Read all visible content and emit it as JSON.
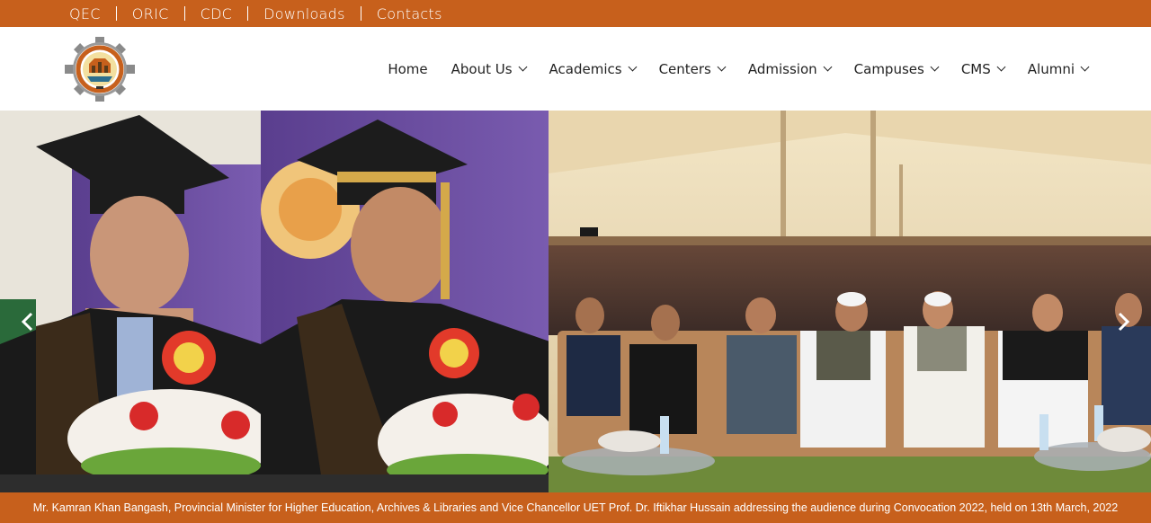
{
  "topbar": {
    "links": [
      "QEC",
      "ORIC",
      "CDC",
      "Downloads",
      "Contacts"
    ]
  },
  "nav": {
    "items": [
      {
        "label": "Home",
        "dropdown": false
      },
      {
        "label": "About Us",
        "dropdown": true
      },
      {
        "label": "Academics",
        "dropdown": true
      },
      {
        "label": "Centers",
        "dropdown": true
      },
      {
        "label": "Admission",
        "dropdown": true
      },
      {
        "label": "Campuses",
        "dropdown": true
      },
      {
        "label": "CMS",
        "dropdown": true
      },
      {
        "label": "Alumni",
        "dropdown": true
      }
    ]
  },
  "slider": {
    "prev_icon": "chevron-left-icon",
    "next_icon": "chevron-right-icon",
    "caption": "Mr. Kamran Khan Bangash, Provincial Minister for Higher Education, Archives & Libraries and Vice Chancellor UET Prof. Dr. Iftikhar Hussain addressing the audience during Convocation 2022, held on 13th March, 2022"
  },
  "colors": {
    "brand": "#c7601c",
    "white": "#ffffff",
    "text": "#222222"
  }
}
